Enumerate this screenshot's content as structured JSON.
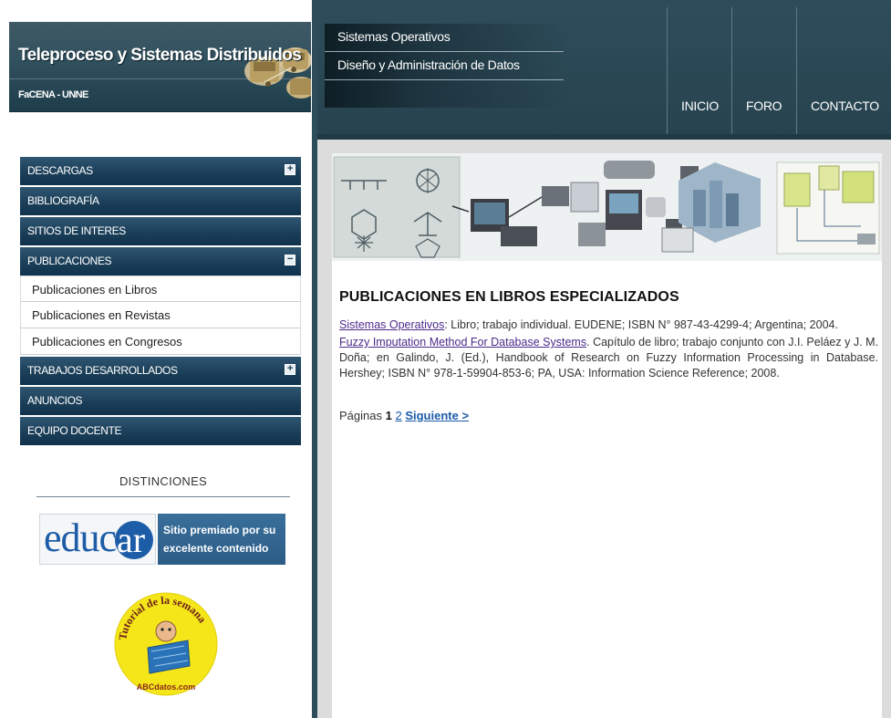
{
  "header": {
    "site_title": "Teleproceso y Sistemas Distribuidos",
    "site_subtitle": "FaCENA - UNNE"
  },
  "menu": {
    "descargas": "DESCARGAS",
    "bibliografia": "BIBLIOGRAFÍA",
    "sitios": "SITIOS DE INTERES",
    "publicaciones": "PUBLICACIONES",
    "publicaciones_sub": [
      "Publicaciones en Libros",
      "Publicaciones en Revistas",
      "Publicaciones en Congresos"
    ],
    "trabajos": "TRABAJOS DESARROLLADOS",
    "anuncios": "ANUNCIOS",
    "equipo": "EQUIPO DOCENTE",
    "expand_glyph": "+",
    "collapse_glyph": "−"
  },
  "distinctions": {
    "title": "DISTINCIONES",
    "educar_logo": "educ",
    "educar_logo_suffix": "ar",
    "educar_caption": "Sitio premiado por su excelente contenido",
    "abc_arc": "Tutorial de la semana",
    "abc_footer": "ABCdatos.com"
  },
  "topnav": {
    "course_links": [
      "Sistemas Operativos",
      "Diseño y Administración de Datos"
    ],
    "inicio": "INICIO",
    "foro": "FORO",
    "contacto": "CONTACTO"
  },
  "main": {
    "heading": "PUBLICACIONES EN LIBROS ESPECIALIZADOS",
    "publications": [
      {
        "title": "Sistemas Operativos",
        "details": ": Libro; trabajo individual. EUDENE; ISBN N° 987-43-4299-4; Argentina; 2004."
      },
      {
        "title": "Fuzzy Imputation Method For Database Systems",
        "details": ". Capítulo de libro; trabajo conjunto con J.I. Peláez y J. M. Doña; en Galindo, J. (Ed.), Handbook of Research on Fuzzy Information Processing in Database. Hershey; ISBN N° 978-1-59904-853-6; PA, USA: Information Science Reference; 2008."
      }
    ],
    "pagination": {
      "label": "Páginas",
      "current": "1",
      "page2": "2",
      "next": "Siguiente >"
    }
  },
  "colors": {
    "menu_blue": "#1c3f59",
    "header_slate": "#2e4d5b",
    "link_purple": "#4b2a8a",
    "link_blue": "#1c5aa8"
  }
}
